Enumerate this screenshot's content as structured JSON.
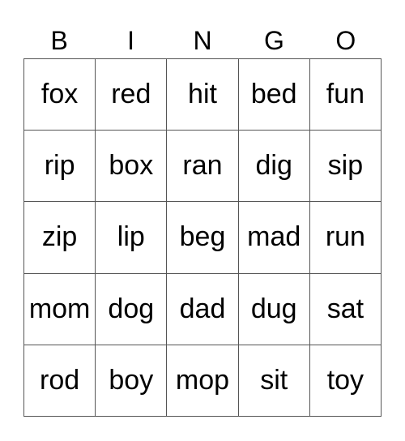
{
  "header": [
    "B",
    "I",
    "N",
    "G",
    "O"
  ],
  "cells": [
    [
      "fox",
      "red",
      "hit",
      "bed",
      "fun"
    ],
    [
      "rip",
      "box",
      "ran",
      "dig",
      "sip"
    ],
    [
      "zip",
      "lip",
      "beg",
      "mad",
      "run"
    ],
    [
      "mom",
      "dog",
      "dad",
      "dug",
      "sat"
    ],
    [
      "rod",
      "boy",
      "mop",
      "sit",
      "toy"
    ]
  ]
}
